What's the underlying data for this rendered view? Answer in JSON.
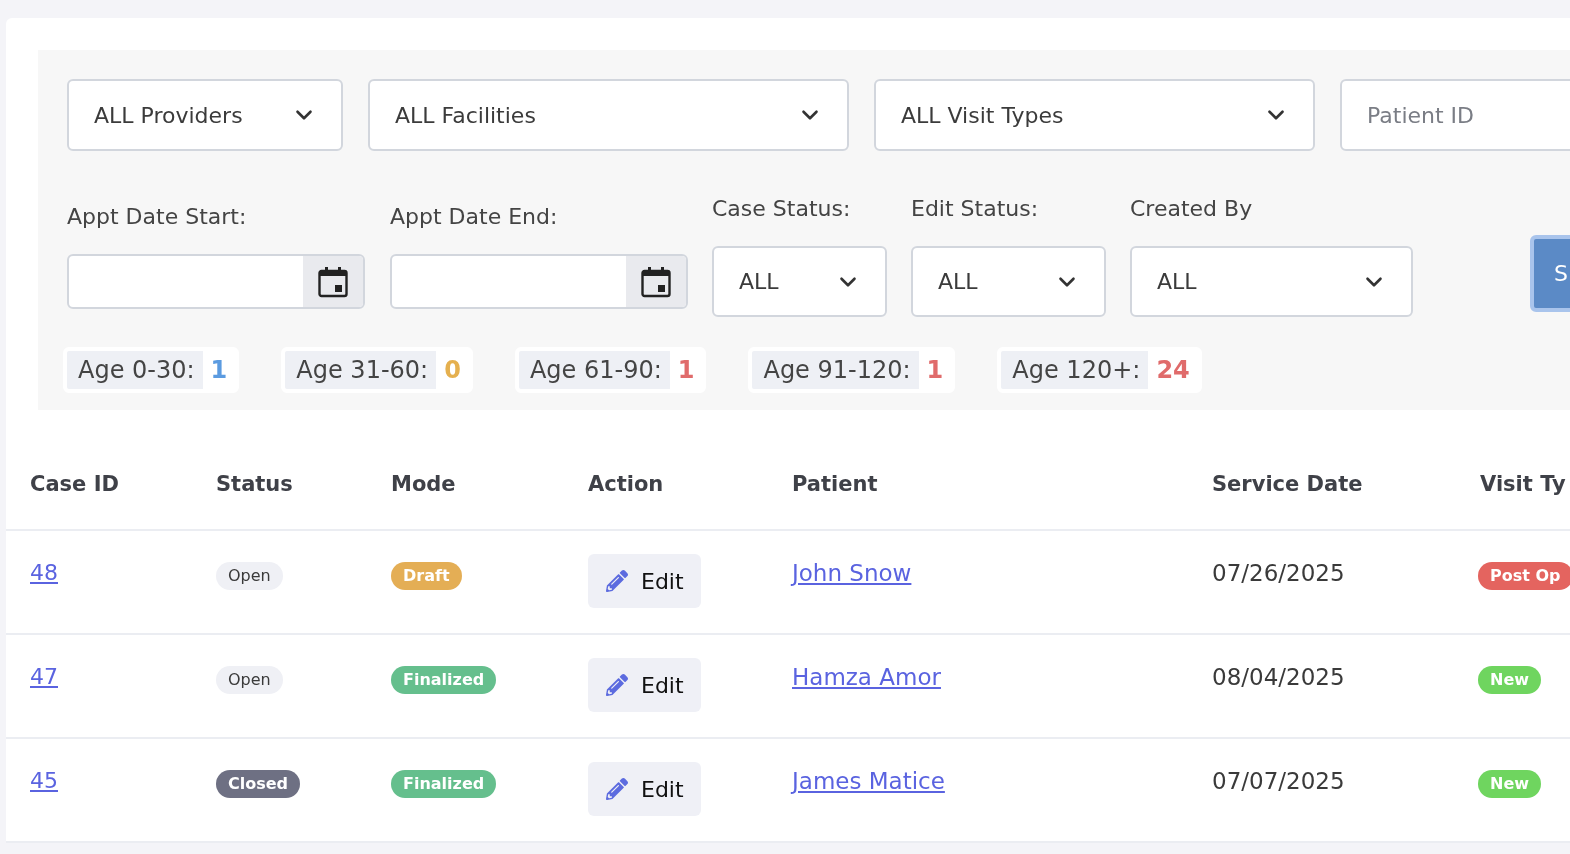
{
  "top_filters": [
    {
      "kind": "select",
      "value": "ALL Providers"
    },
    {
      "kind": "select",
      "value": "ALL Facilities"
    },
    {
      "kind": "select",
      "value": "ALL Visit Types"
    },
    {
      "kind": "text_input",
      "placeholder": "Patient ID"
    }
  ],
  "date_fields": [
    {
      "label": "Appt Date Start:"
    },
    {
      "label": "Appt Date End:"
    }
  ],
  "status_filters": [
    {
      "label": "Case Status:",
      "value": "ALL"
    },
    {
      "label": "Edit Status:",
      "value": "ALL"
    },
    {
      "label": "Created By",
      "value": "ALL"
    }
  ],
  "search_button": {
    "label": "S"
  },
  "age_buckets": [
    {
      "label": "Age 0-30:",
      "count": "1",
      "color": "#5b9be0"
    },
    {
      "label": "Age 31-60:",
      "count": "0",
      "color": "#e5b04f"
    },
    {
      "label": "Age 61-90:",
      "count": "1",
      "color": "#e06b6b"
    },
    {
      "label": "Age 91-120:",
      "count": "1",
      "color": "#e06b6b"
    },
    {
      "label": "Age 120+:",
      "count": "24",
      "color": "#e06b6b"
    }
  ],
  "table": {
    "columns": [
      "Case ID",
      "Status",
      "Mode",
      "Action",
      "Patient",
      "Service Date",
      "Visit Ty"
    ],
    "rows": [
      {
        "case_id": "48",
        "status": {
          "label": "Open",
          "kind": "open"
        },
        "mode": {
          "label": "Draft",
          "color": "#e4ae55"
        },
        "action": "Edit",
        "patient": "John Snow",
        "service_date": "07/26/2025",
        "visit_type": {
          "label": "Post Op",
          "color": "#e4645f"
        }
      },
      {
        "case_id": "47",
        "status": {
          "label": "Open",
          "kind": "open"
        },
        "mode": {
          "label": "Finalized",
          "color": "#65bf8d"
        },
        "action": "Edit",
        "patient": "Hamza Amor",
        "service_date": "08/04/2025",
        "visit_type": {
          "label": "New",
          "color": "#6fd55f"
        }
      },
      {
        "case_id": "45",
        "status": {
          "label": "Closed",
          "kind": "closed"
        },
        "mode": {
          "label": "Finalized",
          "color": "#65bf8d"
        },
        "action": "Edit",
        "patient": "James Matice",
        "service_date": "07/07/2025",
        "visit_type": {
          "label": "New",
          "color": "#6fd55f"
        }
      }
    ]
  }
}
